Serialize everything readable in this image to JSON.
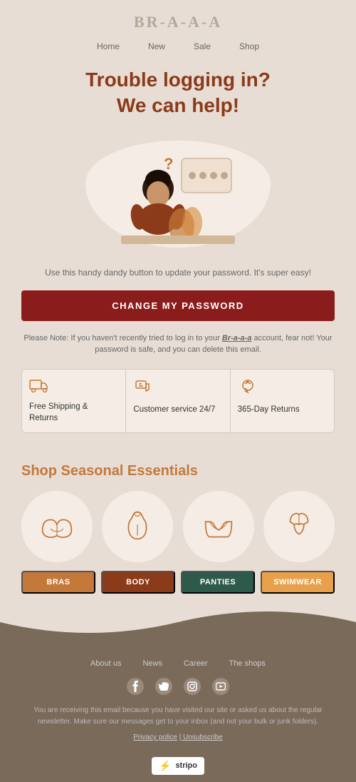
{
  "brand": {
    "logo": "BR-a-a-a",
    "tagline": "BR-a-a-a"
  },
  "nav": {
    "items": [
      {
        "label": "Home"
      },
      {
        "label": "New"
      },
      {
        "label": "Sale"
      },
      {
        "label": "Shop"
      }
    ]
  },
  "hero": {
    "title": "Trouble logging in?\nWe can help!"
  },
  "body": {
    "description": "Use this handy dandy button to update your password. It's super easy!",
    "cta_button": "CHANGE MY PASSWORD",
    "note": "Please Note: If you haven't recently tried to log in to your Br-a-a-a account, fear not! Your password is safe, and you can delete this email."
  },
  "features": [
    {
      "icon": "🚚",
      "label": "Free Shipping & Returns"
    },
    {
      "icon": "🛒",
      "label": "Customer service 24/7"
    },
    {
      "icon": "🎧",
      "label": "365-Day Returns"
    }
  ],
  "seasonal": {
    "title": "Shop Seasonal Essentials",
    "categories": [
      {
        "label": "BRAS",
        "class": "cat-bras"
      },
      {
        "label": "BODY",
        "class": "cat-body"
      },
      {
        "label": "PANTIES",
        "class": "cat-panties"
      },
      {
        "label": "SWIMWEAR",
        "class": "cat-swimwear"
      }
    ]
  },
  "footer": {
    "nav_items": [
      {
        "label": "About us"
      },
      {
        "label": "News"
      },
      {
        "label": "Career"
      },
      {
        "label": "The shops"
      }
    ],
    "social": [
      "f",
      "t",
      "ig",
      "yt"
    ],
    "disclaimer": "You are receiving this email because you have visited our site or asked us about the regular newsletter. Make sure our messages get to your inbox (and not your bulk or junk folders).",
    "privacy_label": "Privacy police",
    "unsubscribe_label": "Unsubscribe",
    "powered_by": "stripo"
  },
  "colors": {
    "brand_red": "#8B1C1C",
    "brand_orange": "#c4783a",
    "bg_light": "#e8ddd4",
    "bg_cream": "#f5ede5",
    "footer_bg": "#7a6a5a"
  }
}
